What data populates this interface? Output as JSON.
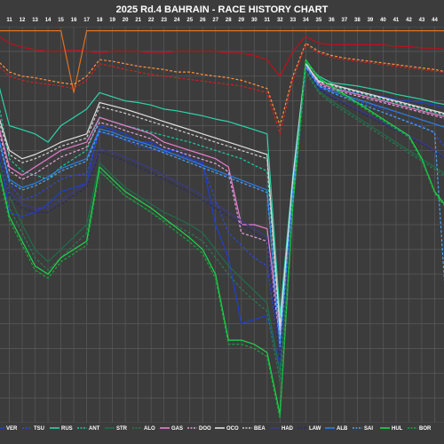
{
  "chart_data": {
    "type": "line",
    "title": "2025 Rd.4 BAHRAIN - RACE HISTORY CHART",
    "xlabel": "",
    "ylabel": "",
    "x": [
      10,
      11,
      12,
      13,
      14,
      15,
      16,
      17,
      18,
      19,
      20,
      21,
      22,
      23,
      24,
      25,
      26,
      27,
      28,
      29,
      30,
      31,
      32,
      33,
      34,
      35,
      36,
      37,
      38,
      39,
      40,
      41,
      42,
      43,
      44,
      45
    ],
    "xlim": [
      10,
      45
    ],
    "ylim": [
      480,
      0
    ],
    "grid": true,
    "legend_position": "bottom",
    "background": "#3c3c3c",
    "grid_color": "#5a5a5a",
    "series": [
      {
        "name": "VER",
        "color": "#1e3fd1",
        "dash": "solid",
        "values": [
          130,
          225,
          230,
          225,
          215,
          200,
          195,
          190,
          120,
          125,
          130,
          140,
          140,
          150,
          150,
          160,
          165,
          240,
          280,
          360,
          355,
          350,
          410,
          180,
          50,
          75,
          75,
          78,
          80,
          82,
          85,
          88,
          90,
          92,
          95,
          100
        ]
      },
      {
        "name": "TSU",
        "color": "#2e47d8",
        "dash": "dash",
        "values": [
          120,
          190,
          210,
          205,
          195,
          185,
          180,
          178,
          128,
          132,
          138,
          145,
          148,
          152,
          155,
          160,
          168,
          210,
          250,
          265,
          280,
          290,
          395,
          200,
          45,
          70,
          80,
          85,
          90,
          95,
          100,
          110,
          115,
          120,
          130,
          150
        ]
      },
      {
        "name": "RUS",
        "color": "#2dd2a8",
        "dash": "solid",
        "values": [
          60,
          120,
          125,
          130,
          140,
          120,
          110,
          100,
          80,
          85,
          90,
          92,
          95,
          100,
          102,
          105,
          108,
          112,
          115,
          120,
          125,
          130,
          350,
          180,
          44,
          60,
          68,
          70,
          72,
          75,
          78,
          82,
          85,
          88,
          92,
          95
        ]
      },
      {
        "name": "ANT",
        "color": "#1ec8a0",
        "dash": "dash",
        "values": [
          80,
          160,
          175,
          180,
          185,
          170,
          160,
          150,
          110,
          115,
          120,
          124,
          128,
          132,
          136,
          140,
          145,
          150,
          155,
          160,
          168,
          175,
          360,
          200,
          48,
          65,
          72,
          76,
          80,
          84,
          88,
          92,
          96,
          100,
          104,
          108
        ]
      },
      {
        "name": "STR",
        "color": "#1f6e4a",
        "dash": "solid",
        "values": [
          150,
          205,
          240,
          270,
          285,
          270,
          255,
          240,
          165,
          180,
          195,
          205,
          215,
          225,
          232,
          240,
          250,
          270,
          290,
          305,
          320,
          335,
          420,
          210,
          52,
          78,
          90,
          100,
          110,
          120,
          130,
          140,
          150,
          160,
          170,
          180
        ]
      },
      {
        "name": "ALO",
        "color": "#2a7a52",
        "dash": "dash",
        "values": [
          170,
          220,
          250,
          280,
          295,
          280,
          265,
          250,
          175,
          190,
          205,
          215,
          225,
          235,
          242,
          250,
          260,
          280,
          300,
          318,
          332,
          345,
          430,
          220,
          55,
          80,
          93,
          103,
          113,
          123,
          133,
          143,
          153,
          163,
          173,
          183
        ]
      },
      {
        "name": "GAS",
        "color": "#e87fd0",
        "dash": "solid",
        "values": [
          110,
          170,
          180,
          170,
          160,
          150,
          145,
          140,
          110,
          115,
          120,
          125,
          130,
          140,
          145,
          150,
          155,
          160,
          170,
          240,
          240,
          245,
          370,
          190,
          46,
          68,
          74,
          78,
          82,
          86,
          90,
          94,
          98,
          102,
          106,
          110
        ]
      },
      {
        "name": "DOO",
        "color": "#e8a0e0",
        "dash": "dash",
        "values": [
          115,
          175,
          185,
          178,
          168,
          158,
          152,
          146,
          116,
          120,
          126,
          131,
          136,
          146,
          151,
          156,
          161,
          166,
          176,
          250,
          255,
          260,
          380,
          195,
          47,
          70,
          76,
          80,
          84,
          88,
          92,
          96,
          100,
          104,
          108,
          112
        ]
      },
      {
        "name": "OCO",
        "color": "#e0e0e0",
        "dash": "solid",
        "values": [
          100,
          150,
          160,
          155,
          148,
          140,
          135,
          130,
          92,
          96,
          100,
          105,
          110,
          115,
          120,
          125,
          130,
          135,
          140,
          145,
          150,
          155,
          365,
          185,
          45,
          66,
          70,
          74,
          78,
          82,
          86,
          90,
          94,
          98,
          102,
          106
        ]
      },
      {
        "name": "BEA",
        "color": "#d0d0d0",
        "dash": "dash",
        "values": [
          105,
          155,
          165,
          160,
          153,
          145,
          140,
          135,
          97,
          101,
          105,
          110,
          115,
          120,
          125,
          130,
          135,
          140,
          145,
          150,
          155,
          160,
          375,
          190,
          46,
          67,
          71,
          75,
          79,
          83,
          87,
          91,
          95,
          99,
          103,
          107
        ]
      },
      {
        "name": "HAD",
        "color": "#3a3a8a",
        "dash": "solid",
        "values": [
          140,
          200,
          215,
          220,
          220,
          210,
          200,
          190,
          148,
          152,
          158,
          165,
          172,
          180,
          188,
          196,
          205,
          215,
          225,
          235,
          245,
          255,
          400,
          205,
          50,
          74,
          84,
          92,
          100,
          108,
          116,
          124,
          132,
          140,
          150,
          160
        ]
      },
      {
        "name": "LAW",
        "color": "#2a2a6a",
        "dash": "dash",
        "values": [
          145,
          205,
          220,
          225,
          225,
          215,
          205,
          195,
          152,
          157,
          163,
          170,
          177,
          185,
          193,
          201,
          210,
          220,
          230,
          240,
          250,
          260,
          405,
          208,
          51,
          75,
          86,
          94,
          102,
          110,
          118,
          126,
          134,
          142,
          152,
          162
        ]
      },
      {
        "name": "ALB",
        "color": "#2b7fe8",
        "dash": "solid",
        "values": [
          125,
          185,
          195,
          190,
          182,
          172,
          166,
          160,
          124,
          128,
          134,
          139,
          144,
          150,
          156,
          162,
          168,
          174,
          180,
          186,
          192,
          198,
          385,
          198,
          48,
          71,
          78,
          83,
          88,
          93,
          98,
          103,
          108,
          113,
          118,
          123
        ]
      },
      {
        "name": "SAI",
        "color": "#4aa0f0",
        "dash": "dash",
        "values": [
          128,
          188,
          198,
          193,
          185,
          175,
          169,
          163,
          127,
          131,
          137,
          142,
          147,
          153,
          159,
          165,
          171,
          177,
          183,
          189,
          195,
          201,
          388,
          200,
          49,
          72,
          80,
          86,
          92,
          98,
          104,
          110,
          116,
          122,
          128,
          365
        ]
      },
      {
        "name": "HUL",
        "color": "#1ed84a",
        "dash": "solid",
        "values": [
          160,
          230,
          260,
          290,
          300,
          280,
          270,
          260,
          170,
          185,
          200,
          210,
          220,
          232,
          244,
          256,
          270,
          300,
          380,
          380,
          385,
          395,
          470,
          215,
          40,
          62,
          72,
          82,
          92,
          102,
          112,
          122,
          132,
          160,
          200,
          220
        ]
      },
      {
        "name": "BOR",
        "color": "#16a83a",
        "dash": "dash",
        "values": [
          165,
          235,
          265,
          295,
          305,
          285,
          275,
          265,
          175,
          190,
          205,
          215,
          225,
          237,
          249,
          261,
          275,
          305,
          385,
          385,
          390,
          400,
          475,
          218,
          41,
          63,
          74,
          84,
          94,
          104,
          114,
          124,
          134,
          162,
          202,
          222
        ]
      },
      {
        "name": "",
        "color": "#c0101a",
        "dash": "solid",
        "values": [
          10,
          20,
          25,
          28,
          30,
          30,
          28,
          30,
          32,
          30,
          30,
          30,
          32,
          32,
          30,
          30,
          30,
          30,
          32,
          32,
          35,
          40,
          60,
          30,
          12,
          20,
          22,
          22,
          22,
          22,
          22,
          24,
          24,
          26,
          26,
          28
        ]
      },
      {
        "name": "",
        "color": "#e07020",
        "dash": "solid",
        "values": [
          5,
          5,
          5,
          5,
          5,
          5,
          80,
          5,
          5,
          5,
          5,
          5,
          5,
          5,
          5,
          5,
          5,
          5,
          5,
          5,
          5,
          5,
          5,
          5,
          5,
          5,
          5,
          5,
          5,
          5,
          5,
          5,
          5,
          5,
          5,
          5
        ]
      },
      {
        "name": "",
        "color": "#ff9040",
        "dash": "dash",
        "values": [
          40,
          55,
          60,
          62,
          65,
          68,
          70,
          60,
          40,
          42,
          45,
          48,
          50,
          52,
          55,
          55,
          58,
          60,
          62,
          65,
          70,
          75,
          120,
          60,
          20,
          30,
          35,
          38,
          40,
          42,
          44,
          46,
          48,
          50,
          52,
          55
        ]
      },
      {
        "name": "",
        "color": "#d02020",
        "dash": "dash",
        "values": [
          45,
          60,
          65,
          68,
          70,
          72,
          75,
          65,
          45,
          48,
          52,
          55,
          58,
          60,
          62,
          64,
          66,
          68,
          70,
          72,
          76,
          80,
          130,
          65,
          22,
          32,
          37,
          40,
          42,
          44,
          46,
          48,
          50,
          52,
          54,
          56
        ]
      }
    ]
  }
}
